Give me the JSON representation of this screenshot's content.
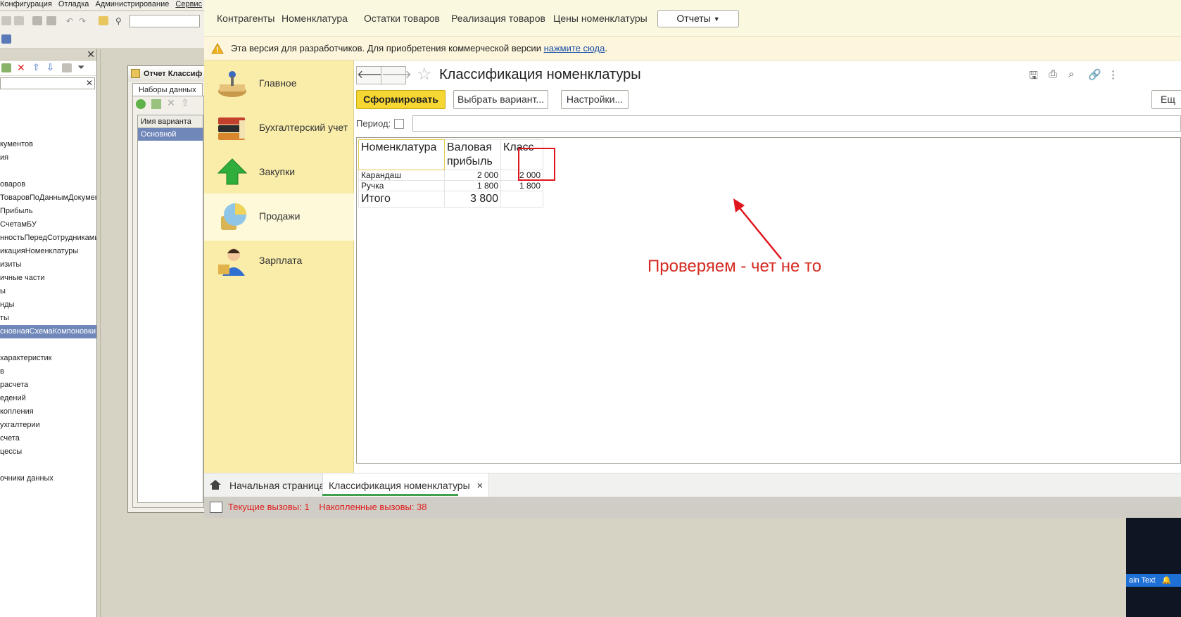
{
  "configurator": {
    "menu": [
      "Конфигурация",
      "Отладка",
      "Администрирование",
      "Сервис"
    ],
    "tree_items": [
      {
        "label": "",
        "selected": false
      },
      {
        "label": "",
        "selected": false
      },
      {
        "label": "",
        "selected": false
      },
      {
        "label": "кументов",
        "selected": false
      },
      {
        "label": "ия",
        "selected": false
      },
      {
        "label": "",
        "selected": false
      },
      {
        "label": "оваров",
        "selected": false
      },
      {
        "label": "ТоваровПоДаннымДокументов",
        "selected": false
      },
      {
        "label": "Прибыль",
        "selected": false
      },
      {
        "label": "СчетамБУ",
        "selected": false
      },
      {
        "label": "нностьПередСотрудниками",
        "selected": false
      },
      {
        "label": "икацияНоменклатуры",
        "selected": false
      },
      {
        "label": "изиты",
        "selected": false
      },
      {
        "label": "ичные части",
        "selected": false
      },
      {
        "label": "ы",
        "selected": false
      },
      {
        "label": "нды",
        "selected": false
      },
      {
        "label": "ты",
        "selected": false
      },
      {
        "label": "сновнаяСхемаКомпоновки",
        "selected": true
      },
      {
        "label": "",
        "selected": false
      },
      {
        "label": "характеристик",
        "selected": false
      },
      {
        "label": "в",
        "selected": false
      },
      {
        "label": "расчета",
        "selected": false
      },
      {
        "label": "едений",
        "selected": false
      },
      {
        "label": "копления",
        "selected": false
      },
      {
        "label": "ухгалтерии",
        "selected": false
      },
      {
        "label": "счета",
        "selected": false
      },
      {
        "label": "цессы",
        "selected": false
      },
      {
        "label": "",
        "selected": false
      },
      {
        "label": "очники данных",
        "selected": false
      }
    ],
    "dialog": {
      "title": "Отчет Классиф",
      "tab": "Наборы данных",
      "grid_header": "Имя варианта",
      "grid_row": "Основной"
    }
  },
  "nav": {
    "items": [
      "Контрагенты",
      "Номенклатура",
      "Остатки товаров",
      "Реализация товаров",
      "Цены номенклатуры"
    ],
    "reports": "Отчеты"
  },
  "banner": {
    "text": "Эта версия для разработчиков. Для приобретения коммерческой версии ",
    "link": "нажмите сюда",
    "tail": "."
  },
  "sections": [
    {
      "label": "Главное",
      "active": false
    },
    {
      "label": "Бухгалтерский учет",
      "active": false
    },
    {
      "label": "Закупки",
      "active": false
    },
    {
      "label": "Продажи",
      "active": true
    },
    {
      "label": "Зарплата",
      "active": false
    }
  ],
  "report": {
    "title": "Классификация номенклатуры",
    "generate": "Сформировать",
    "choose_variant": "Выбрать вариант...",
    "settings": "Настройки...",
    "more": "Ещ",
    "period_label": "Период:",
    "columns": [
      "Номенклатура",
      "Валовая прибыль",
      "Класс"
    ],
    "rows": [
      {
        "name": "Карандаш",
        "profit": "2 000",
        "class": "2 000"
      },
      {
        "name": "Ручка",
        "profit": "1 800",
        "class": "1 800"
      }
    ],
    "total": {
      "name": "Итого",
      "profit": "3 800",
      "class": ""
    },
    "annotation": "Проверяем - чет не то"
  },
  "tabs": {
    "home": "Начальная страница",
    "doc": "Классификация номенклатуры",
    "close": "×"
  },
  "status": {
    "current": "Текущие вызовы: 1",
    "accumulated": "Накопленные вызовы: 38"
  },
  "corner": {
    "text": "ain Text"
  },
  "colors": {
    "accent": "#f6d633",
    "annotation": "#d42a21",
    "sections_bg": "#faedaa",
    "banner_link": "#1a4ea8"
  }
}
